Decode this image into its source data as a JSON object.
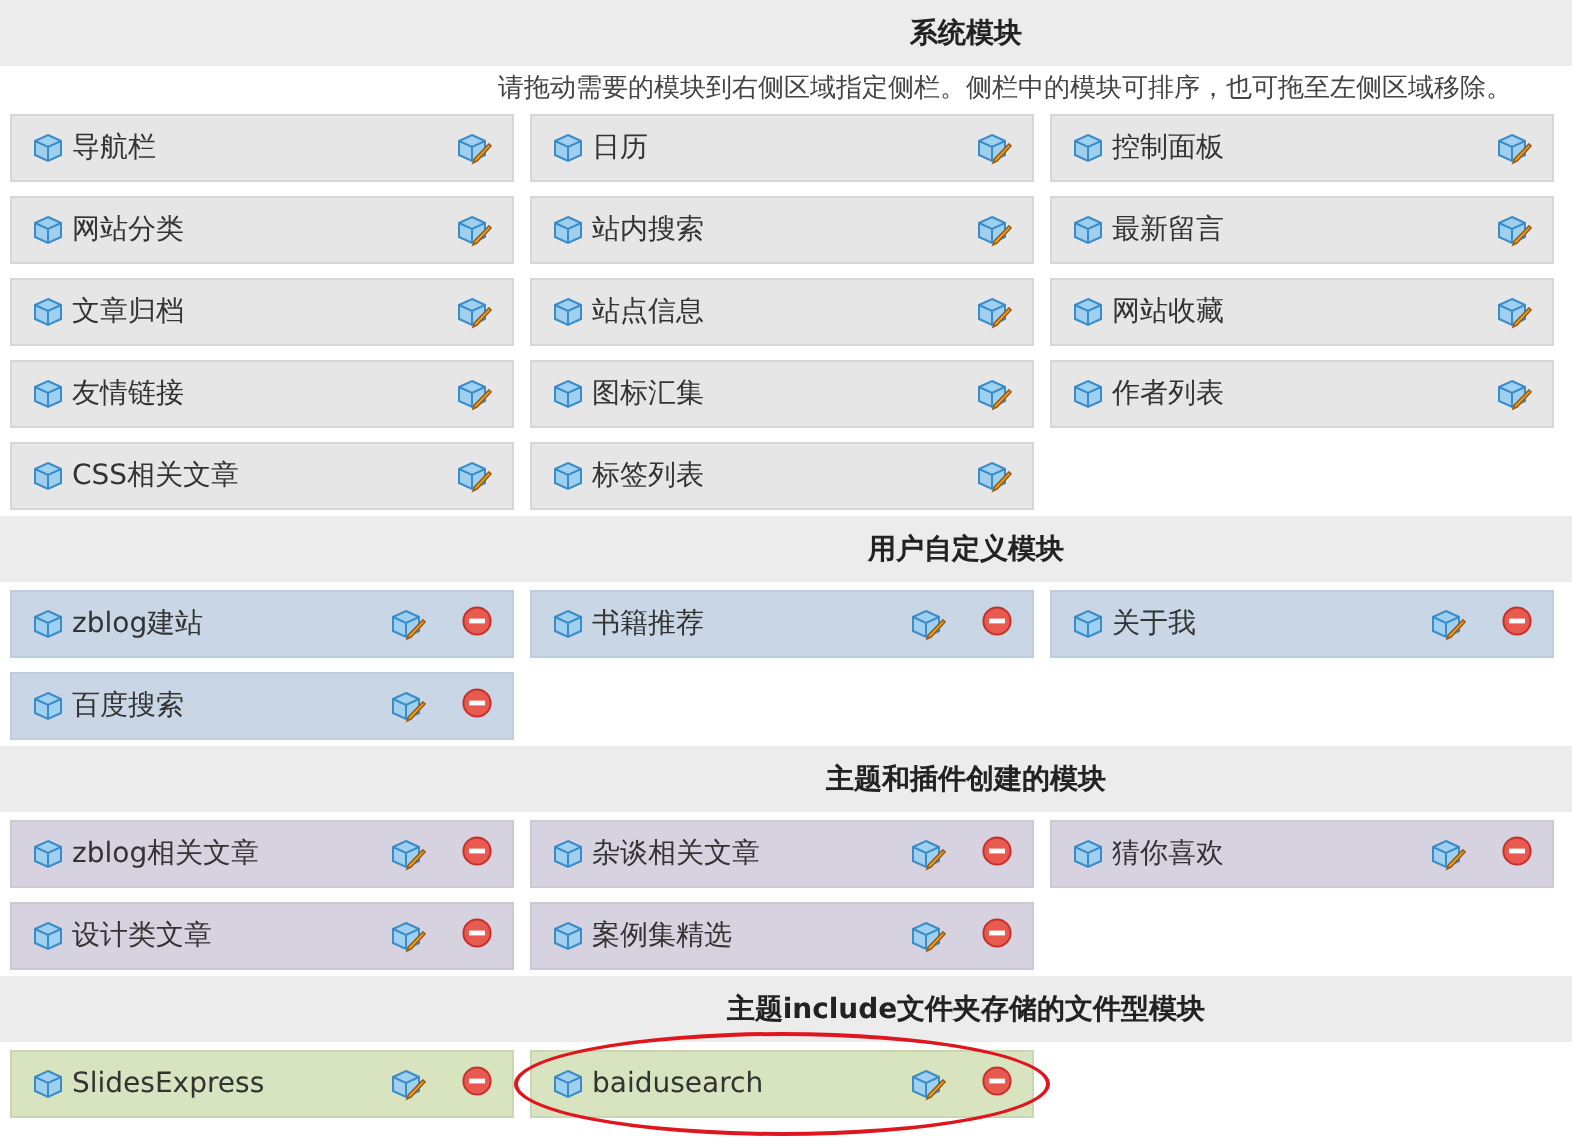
{
  "sections": [
    {
      "title": "系统模块",
      "kind": "system",
      "description": "请拖动需要的模块到右侧区域指定侧栏。侧栏中的模块可排序，也可拖至左侧区域移除。",
      "modules": [
        {
          "name": "导航栏"
        },
        {
          "name": "日历"
        },
        {
          "name": "控制面板"
        },
        {
          "name": "网站分类"
        },
        {
          "name": "站内搜索"
        },
        {
          "name": "最新留言"
        },
        {
          "name": "文章归档"
        },
        {
          "name": "站点信息"
        },
        {
          "name": "网站收藏"
        },
        {
          "name": "友情链接"
        },
        {
          "name": "图标汇集"
        },
        {
          "name": "作者列表"
        },
        {
          "name": "CSS相关文章"
        },
        {
          "name": "标签列表"
        }
      ]
    },
    {
      "title": "用户自定义模块",
      "kind": "user",
      "modules": [
        {
          "name": "zblog建站"
        },
        {
          "name": "书籍推荐"
        },
        {
          "name": "关于我"
        },
        {
          "name": "百度搜索"
        }
      ]
    },
    {
      "title": "主题和插件创建的模块",
      "kind": "theme",
      "modules": [
        {
          "name": "zblog相关文章"
        },
        {
          "name": "杂谈相关文章"
        },
        {
          "name": "猜你喜欢"
        },
        {
          "name": "设计类文章"
        },
        {
          "name": "案例集精选"
        }
      ]
    },
    {
      "title": "主题include文件夹存储的文件型模块",
      "kind": "file",
      "modules": [
        {
          "name": "SlidesExpress",
          "circled": false
        },
        {
          "name": "baidusearch",
          "circled": true
        }
      ]
    }
  ]
}
